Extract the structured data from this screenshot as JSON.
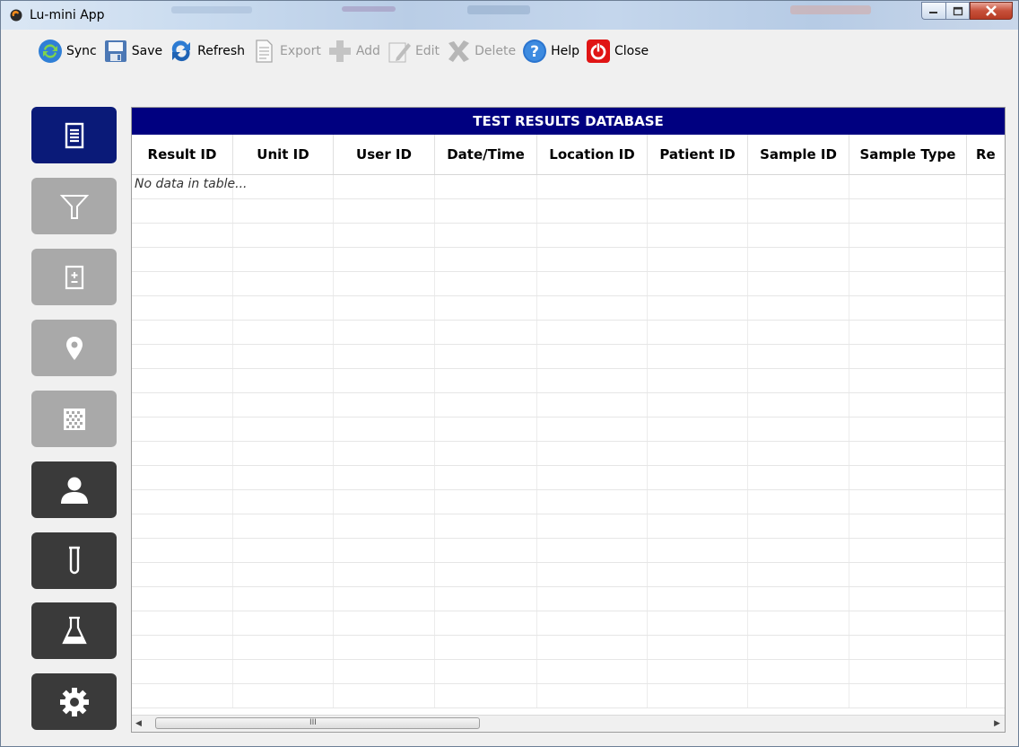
{
  "window": {
    "title": "Lu-mini App"
  },
  "toolbar": {
    "sync": "Sync",
    "save": "Save",
    "refresh": "Refresh",
    "export": "Export",
    "add": "Add",
    "edit": "Edit",
    "delete": "Delete",
    "help": "Help",
    "close": "Close"
  },
  "sidebar": {
    "items": [
      {
        "name": "results",
        "icon": "list-document-icon",
        "state": "active"
      },
      {
        "name": "filter",
        "icon": "filter-funnel-icon",
        "state": "disabled"
      },
      {
        "name": "calculator",
        "icon": "calculator-icon",
        "state": "disabled"
      },
      {
        "name": "location",
        "icon": "map-pin-icon",
        "state": "disabled"
      },
      {
        "name": "barcode",
        "icon": "data-matrix-icon",
        "state": "disabled"
      },
      {
        "name": "user",
        "icon": "user-icon",
        "state": "enabled"
      },
      {
        "name": "sample",
        "icon": "test-tube-icon",
        "state": "enabled"
      },
      {
        "name": "lab",
        "icon": "flask-icon",
        "state": "enabled"
      },
      {
        "name": "settings",
        "icon": "gear-icon",
        "state": "enabled"
      }
    ]
  },
  "table": {
    "title": "TEST RESULTS DATABASE",
    "columns": [
      "Result ID",
      "Unit ID",
      "User ID",
      "Date/Time",
      "Location ID",
      "Patient ID",
      "Sample ID",
      "Sample Type",
      "Re"
    ],
    "empty_message": "No data in table...",
    "rows": []
  },
  "scrollbar": {
    "grip": "III"
  },
  "colors": {
    "header_bg": "#000080",
    "active_nav": "#0a1a78",
    "disabled_nav": "#a9a9a9",
    "enabled_nav": "#3a3a3a"
  }
}
